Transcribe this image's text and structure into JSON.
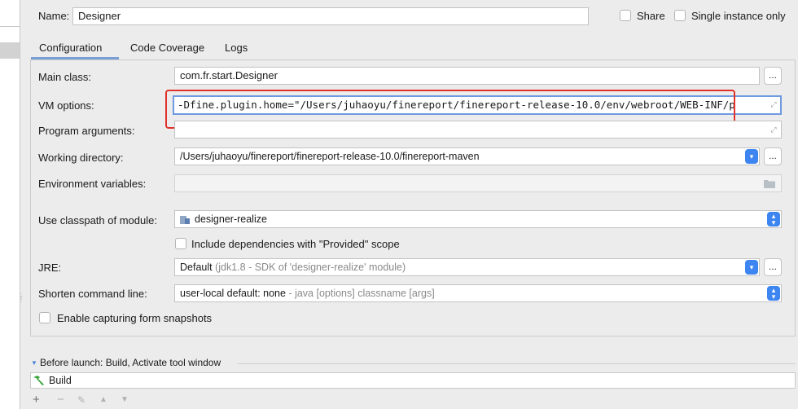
{
  "header": {
    "name_label": "Name:",
    "name_value": "Designer",
    "share_label": "Share",
    "single_instance_label": "Single instance only"
  },
  "tabs": [
    {
      "label": "Configuration",
      "active": true
    },
    {
      "label": "Code Coverage",
      "active": false
    },
    {
      "label": "Logs",
      "active": false
    }
  ],
  "form": {
    "main_class_label": "Main class:",
    "main_class_value": "com.fr.start.Designer",
    "vm_options_label": "VM options:",
    "vm_options_value": "-Dfine.plugin.home=\"/Users/juhaoyu/finereport/finereport-release-10.0/env/webroot/WEB-INF/p",
    "program_arguments_label": "Program arguments:",
    "program_arguments_value": "",
    "working_directory_label": "Working directory:",
    "working_directory_value": "/Users/juhaoyu/finereport/finereport-release-10.0/finereport-maven",
    "env_vars_label": "Environment variables:",
    "env_vars_value": "",
    "classpath_label": "Use classpath of module:",
    "classpath_value": "designer-realize",
    "include_deps_label": "Include dependencies with \"Provided\" scope",
    "jre_label": "JRE:",
    "jre_value_main": "Default",
    "jre_value_hint": "(jdk1.8 - SDK of 'designer-realize' module)",
    "shorten_label": "Shorten command line:",
    "shorten_value_main": "user-local default: none",
    "shorten_value_hint": "- java [options] classname [args]",
    "capture_label": "Enable capturing form snapshots",
    "ellipsis": "..."
  },
  "before_launch": {
    "title": "Before launch: Build, Activate tool window",
    "items": [
      "Build"
    ]
  },
  "icons": {
    "expand": "expand-icon",
    "folder": "folder-icon",
    "module": "module-icon",
    "stepper": "stepper-icon",
    "dropdown": "chevron-down-icon",
    "build": "hammer-icon",
    "add": "plus-icon",
    "remove": "minus-icon",
    "edit": "pencil-icon",
    "up": "arrow-up-icon",
    "down": "arrow-down-icon"
  },
  "colors": {
    "accent": "#3d85f0",
    "highlight": "#e0322a",
    "build_icon": "#3aa33a"
  }
}
